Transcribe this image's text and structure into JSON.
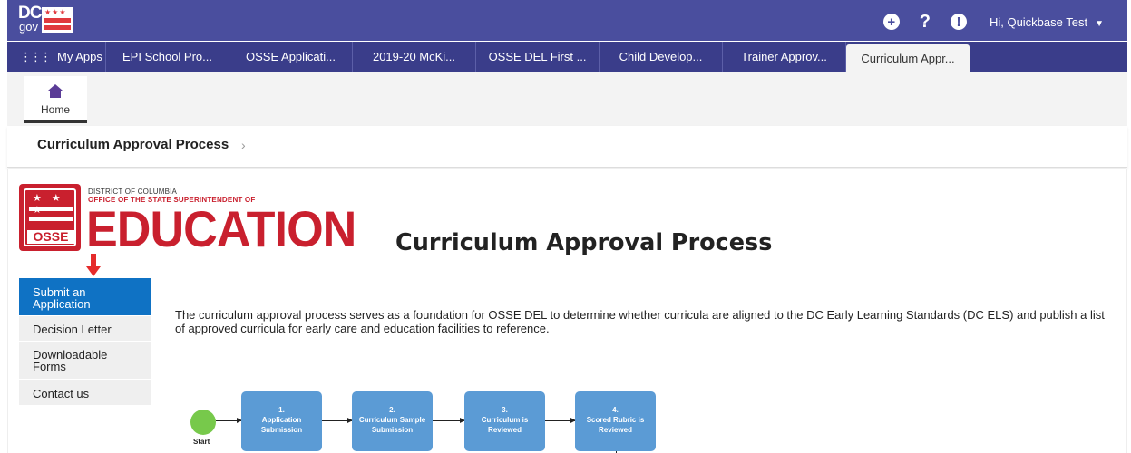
{
  "topbar": {
    "logo": {
      "dc": "DC",
      "gov": "gov"
    },
    "icons": [
      "plus-circle-icon",
      "help-icon",
      "alert-icon"
    ],
    "user_label": "Hi, Quickbase Test"
  },
  "app_tabs": {
    "my_apps": "My Apps",
    "tabs": [
      {
        "label": "EPI School Pro..."
      },
      {
        "label": "OSSE Applicati..."
      },
      {
        "label": "2019-20 McKi..."
      },
      {
        "label": "OSSE DEL First ..."
      },
      {
        "label": "Child Develop..."
      },
      {
        "label": "Trainer Approv..."
      },
      {
        "label": "Curriculum Appr..."
      }
    ]
  },
  "home": {
    "label": "Home"
  },
  "breadcrumb": {
    "title": "Curriculum Approval Process"
  },
  "logo": {
    "district": "DISTRICT OF COLUMBIA",
    "office": "OFFICE OF THE STATE SUPERINTENDENT OF",
    "education": "EDUCATION",
    "badge_word": "OSSE",
    "badge_stars": "★ ★ ★"
  },
  "page": {
    "title": "Curriculum Approval Process",
    "intro": "The curriculum approval process serves as a foundation for OSSE DEL to determine whether curricula are aligned to the DC Early Learning Standards (DC ELS) and publish a list of approved curricula for early care and education facilities to reference."
  },
  "sidenav": {
    "items": [
      {
        "label": "Submit an Application"
      },
      {
        "label": "Decision Letter"
      },
      {
        "label": "Downloadable Forms"
      },
      {
        "label": "Contact us"
      }
    ]
  },
  "flow": {
    "start": "Start",
    "steps": [
      {
        "num": "1.",
        "label": "Application Submission"
      },
      {
        "num": "2.",
        "label": "Curriculum Sample Submission"
      },
      {
        "num": "3.",
        "label": "Curriculum is Reviewed"
      },
      {
        "num": "4.",
        "label": "Scored Rubric is Reviewed"
      }
    ]
  },
  "colors": {
    "topbar": "#4a4e9e",
    "tabbar": "#3a3d8a",
    "osse_red": "#c9202e",
    "nav_active": "#0f72c4",
    "flow_box": "#5b9bd5",
    "start_green": "#77c94b"
  }
}
